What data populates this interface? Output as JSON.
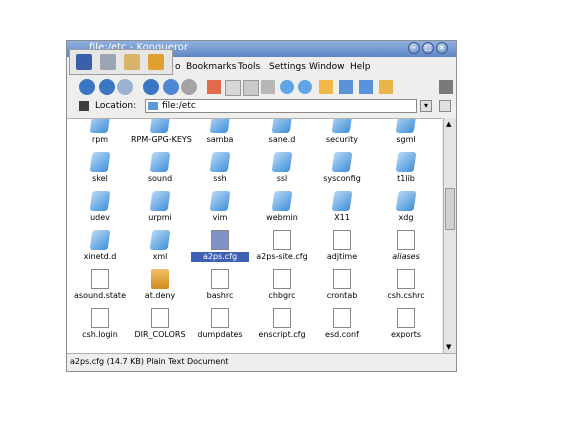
{
  "window": {
    "title": "file:/etc - Konqueror"
  },
  "menu": [
    {
      "label": "o"
    },
    {
      "label": "Bookmarks"
    },
    {
      "label": "Tools"
    },
    {
      "label": "Settings"
    },
    {
      "label": "Window"
    },
    {
      "label": "Help"
    }
  ],
  "location": {
    "label": "Location:",
    "value": "file:/etc"
  },
  "files": [
    {
      "name": "rpm",
      "type": "folder"
    },
    {
      "name": "RPM-GPG-KEYS",
      "type": "folder"
    },
    {
      "name": "samba",
      "type": "folder"
    },
    {
      "name": "sane.d",
      "type": "folder"
    },
    {
      "name": "security",
      "type": "folder"
    },
    {
      "name": "sgml",
      "type": "folder"
    },
    {
      "name": "skel",
      "type": "folder"
    },
    {
      "name": "sound",
      "type": "folder"
    },
    {
      "name": "ssh",
      "type": "folder"
    },
    {
      "name": "ssl",
      "type": "folder"
    },
    {
      "name": "sysconfig",
      "type": "folder"
    },
    {
      "name": "t1lib",
      "type": "folder"
    },
    {
      "name": "udev",
      "type": "folder"
    },
    {
      "name": "urpmi",
      "type": "folder"
    },
    {
      "name": "vim",
      "type": "folder"
    },
    {
      "name": "webmin",
      "type": "locked-folder"
    },
    {
      "name": "X11",
      "type": "folder"
    },
    {
      "name": "xdg",
      "type": "folder"
    },
    {
      "name": "xinetd.d",
      "type": "folder"
    },
    {
      "name": "xml",
      "type": "folder"
    },
    {
      "name": "a2ps.cfg",
      "type": "text",
      "selected": true
    },
    {
      "name": "a2ps-site.cfg",
      "type": "text"
    },
    {
      "name": "adjtime",
      "type": "text"
    },
    {
      "name": "aliases",
      "type": "text"
    },
    {
      "name": "asound.state",
      "type": "text"
    },
    {
      "name": "at.deny",
      "type": "locked-file"
    },
    {
      "name": "bashrc",
      "type": "text"
    },
    {
      "name": "chbgrc",
      "type": "text"
    },
    {
      "name": "crontab",
      "type": "text"
    },
    {
      "name": "csh.cshrc",
      "type": "text"
    },
    {
      "name": "csh.login",
      "type": "text"
    },
    {
      "name": "DIR_COLORS",
      "type": "text"
    },
    {
      "name": "dumpdates",
      "type": "text"
    },
    {
      "name": "enscript.cfg",
      "type": "text"
    },
    {
      "name": "esd.conf",
      "type": "text"
    },
    {
      "name": "exports",
      "type": "text"
    }
  ],
  "status": {
    "text": "a2ps.cfg (14.7 KB)  Plain Text Document"
  }
}
